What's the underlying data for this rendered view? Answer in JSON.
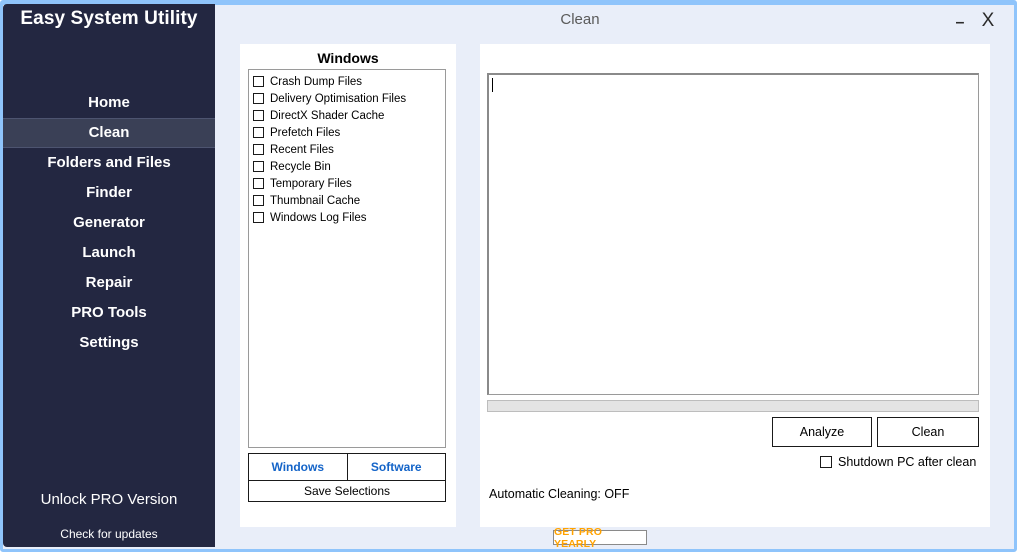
{
  "window": {
    "title": "Clean",
    "minimize_label": "–",
    "close_label": "X"
  },
  "sidebar": {
    "brand": "Easy System Utility",
    "items": [
      {
        "label": "Home",
        "active": false
      },
      {
        "label": "Clean",
        "active": true
      },
      {
        "label": "Folders and Files",
        "active": false
      },
      {
        "label": "Finder",
        "active": false
      },
      {
        "label": "Generator",
        "active": false
      },
      {
        "label": "Launch",
        "active": false
      },
      {
        "label": "Repair",
        "active": false
      },
      {
        "label": "PRO Tools",
        "active": false
      },
      {
        "label": "Settings",
        "active": false
      }
    ],
    "unlock_pro": "Unlock PRO Version",
    "check_updates": "Check for updates"
  },
  "left_panel": {
    "title": "Windows",
    "items": [
      {
        "label": "Crash Dump Files",
        "checked": false
      },
      {
        "label": "Delivery Optimisation Files",
        "checked": false
      },
      {
        "label": "DirectX Shader Cache",
        "checked": false
      },
      {
        "label": "Prefetch Files",
        "checked": false
      },
      {
        "label": "Recent Files",
        "checked": false
      },
      {
        "label": "Recycle Bin",
        "checked": false
      },
      {
        "label": "Temporary Files",
        "checked": false
      },
      {
        "label": "Thumbnail Cache",
        "checked": false
      },
      {
        "label": "Windows Log Files",
        "checked": false
      }
    ],
    "tabs": [
      {
        "label": "Windows",
        "selected": true
      },
      {
        "label": "Software",
        "selected": false
      }
    ],
    "save_selections_label": "Save Selections"
  },
  "right_panel": {
    "log_value": "",
    "progress_percent": 0,
    "analyze_label": "Analyze",
    "clean_label": "Clean",
    "shutdown_label": "Shutdown PC after clean",
    "shutdown_checked": false,
    "automatic_cleaning_status": "Automatic Cleaning: OFF"
  },
  "footer": {
    "get_pro_label": "GET PRO YEARLY"
  },
  "colors": {
    "sidebar_bg": "#232741",
    "sidebar_active": "#3a4056",
    "window_border": "#8fc4fb",
    "content_bg": "#e9eef9",
    "tab_link": "#1464c8",
    "pro_orange": "#ffa200"
  }
}
